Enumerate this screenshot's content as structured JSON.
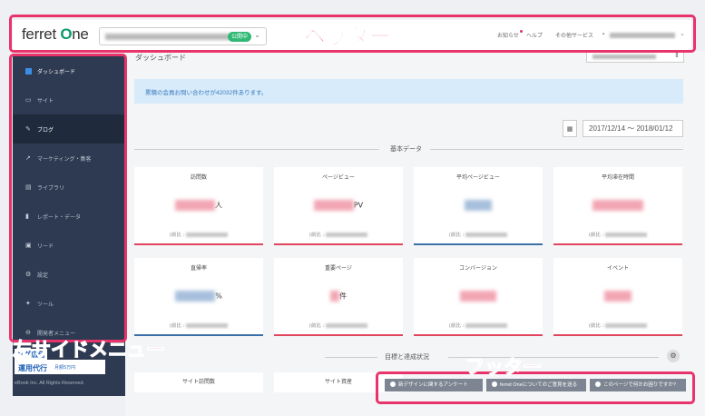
{
  "colors": {
    "annotation": "#e8336b",
    "sidebar_bg": "#2e3a51",
    "accent_green": "#2fb974",
    "bar_red": "#e0455d",
    "bar_blue": "#3b6fa8"
  },
  "header": {
    "logo_prefix": "ferret ",
    "logo_o": "O",
    "logo_suffix": "ne",
    "site_badge": "公開中",
    "nav": [
      "お知らせ",
      "ヘルプ",
      "その他サービス"
    ]
  },
  "sidebar": {
    "items": [
      {
        "label": "ダッシュボード",
        "icon": "dashboard-icon"
      },
      {
        "label": "サイト",
        "icon": "site-icon"
      },
      {
        "label": "ブログ",
        "icon": "pen-icon"
      },
      {
        "label": "マーケティング・集客",
        "icon": "chart-line-icon"
      },
      {
        "label": "ライブラリ",
        "icon": "library-icon"
      },
      {
        "label": "レポート・データ",
        "icon": "bar-chart-icon"
      },
      {
        "label": "リード",
        "icon": "lead-icon"
      },
      {
        "label": "設定",
        "icon": "gear-icon"
      },
      {
        "label": "ツール",
        "icon": "wrench-icon"
      },
      {
        "label": "開発者メニュー",
        "icon": "dev-icon"
      }
    ],
    "promo": "運用代行",
    "promo_top": "ング広告",
    "promo_sub": "月額5万円",
    "copyright": "eBook Inc. All Rights Reserved."
  },
  "main": {
    "page_title": "ダッシュボード",
    "notice": "累積の会員お問い合わせが42032件あります。",
    "date_range": "2017/12/14 ～ 2018/01/12",
    "section_basic": "基本データ",
    "cards": [
      {
        "label": "訪問数",
        "unit": "人",
        "prev": "(前比 :",
        "bar": "red"
      },
      {
        "label": "ページビュー",
        "unit": "PV",
        "prev": "(前比 :",
        "bar": "red"
      },
      {
        "label": "平均ページビュー",
        "unit": "",
        "prev": "(前比 :",
        "bar": "blue"
      },
      {
        "label": "平均滞在時間",
        "unit": "",
        "prev": "(前比 :",
        "bar": "red"
      },
      {
        "label": "直帰率",
        "unit": "%",
        "prev": "(前比 :",
        "bar": "blue"
      },
      {
        "label": "重要ページ",
        "unit": "件",
        "prev": "(前比 :",
        "bar": "red"
      },
      {
        "label": "コンバージョン",
        "unit": "",
        "prev": "(前比 :",
        "bar": "red"
      },
      {
        "label": "イベント",
        "unit": "",
        "prev": "(前比 :",
        "bar": "red"
      }
    ],
    "section_goal": "目標と達成状況",
    "goal_cards": [
      "サイト訪問数",
      "サイト資産"
    ]
  },
  "footer": {
    "buttons": [
      "新デザインに関するアンケート",
      "ferret Oneについてのご意見を送る",
      "このページで何かお困りですか?"
    ]
  },
  "annotations": {
    "header": "ヘッダー",
    "sidebar": "左サイドメニュー",
    "footer": "フッター"
  }
}
